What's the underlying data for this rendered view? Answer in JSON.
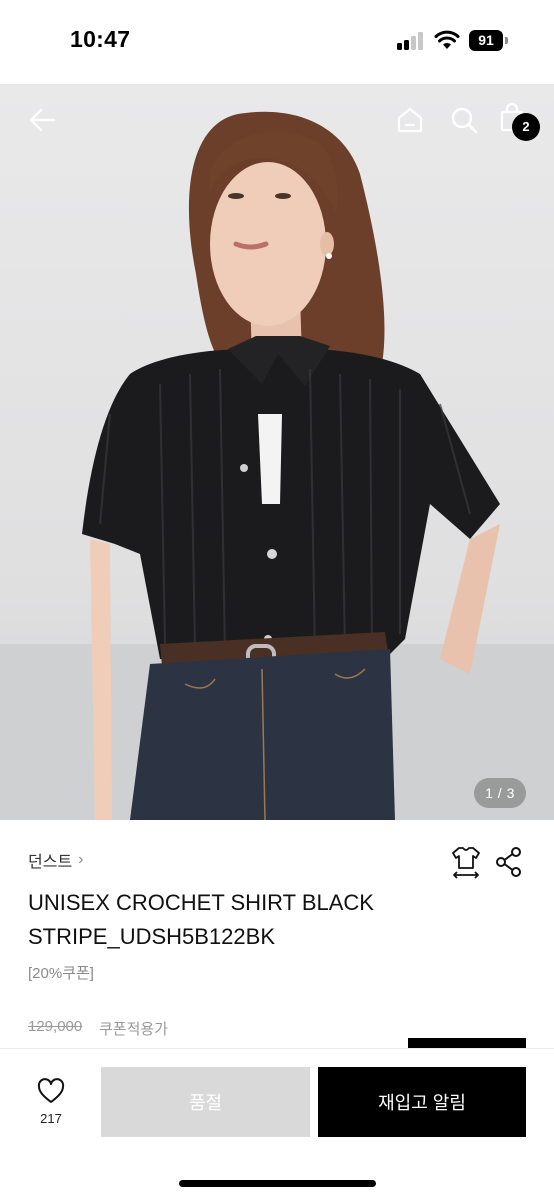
{
  "status_bar": {
    "time": "10:47",
    "battery": "91"
  },
  "header": {
    "icons": [
      "back-arrow-icon",
      "home-icon",
      "search-icon",
      "shopping-bag-icon"
    ],
    "cart_count": "2"
  },
  "gallery": {
    "page_indicator": "1 / 3"
  },
  "product": {
    "brand": "던스트",
    "title": "UNISEX CROCHET SHIRT BLACK STRIPE_UDSH5B122BK",
    "coupon_tag": "[20%쿠폰]",
    "price_original": "129,000",
    "coupon_price_label": "쿠폰적용가"
  },
  "actions": {
    "like_count": "217",
    "soldout_label": "품절",
    "restock_alert_label": "재입고 알림"
  },
  "colors": {
    "accent": "#000000",
    "disabled": "#d9d9d9"
  }
}
